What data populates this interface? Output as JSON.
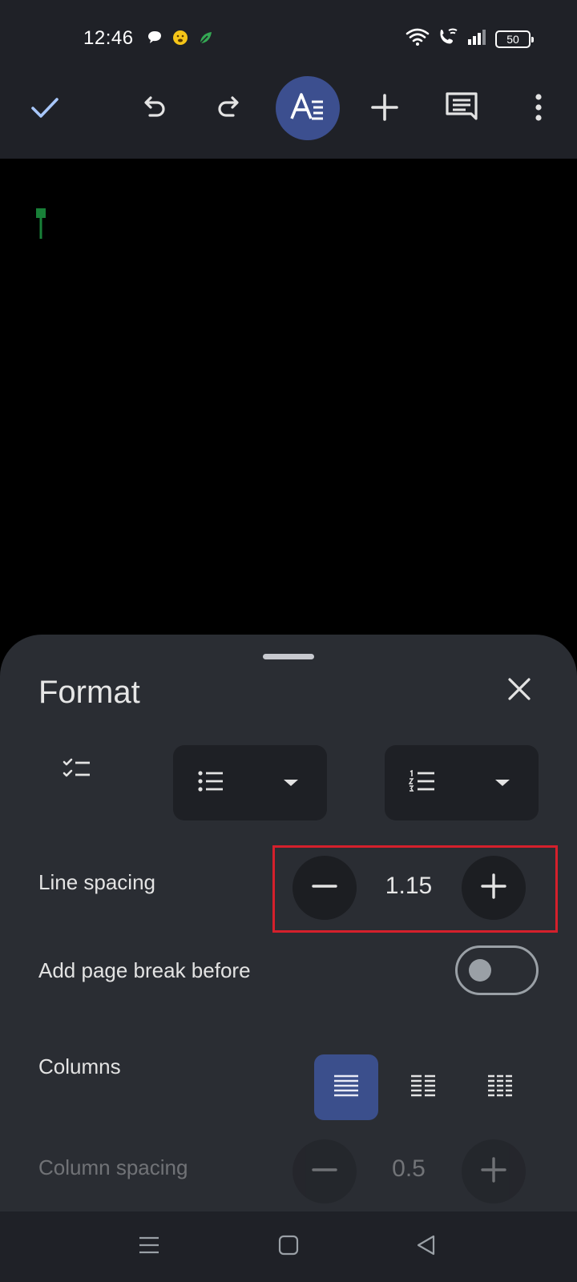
{
  "status_bar": {
    "time": "12:46",
    "battery": "50",
    "left_icons": [
      "chat-bubble-icon",
      "emoji-icon",
      "leaf-icon"
    ],
    "right_icons": [
      "wifi-icon",
      "wifi-call-icon",
      "signal-icon",
      "battery-icon"
    ]
  },
  "toolbar": {
    "icons": [
      "check-icon",
      "undo-icon",
      "redo-icon",
      "text-format-icon",
      "add-icon",
      "comment-icon",
      "more-vert-icon"
    ],
    "accent": "#3c4f8f",
    "check_color": "#a8c7fa"
  },
  "document": {
    "cursor_color": "#188038"
  },
  "format_sheet": {
    "title": "Format",
    "line_spacing": {
      "label": "Line spacing",
      "value": "1.15"
    },
    "page_break": {
      "label": "Add page break before",
      "enabled": false
    },
    "columns": {
      "label": "Columns",
      "options": [
        "one-column-icon",
        "two-column-icon",
        "three-column-icon"
      ],
      "selected": 0
    },
    "column_spacing": {
      "label": "Column spacing",
      "value": "0.5",
      "disabled": true
    },
    "highlight_color": "#d5202c"
  },
  "nav_bar": {
    "icons": [
      "menu-icon",
      "home-icon",
      "back-icon"
    ]
  }
}
